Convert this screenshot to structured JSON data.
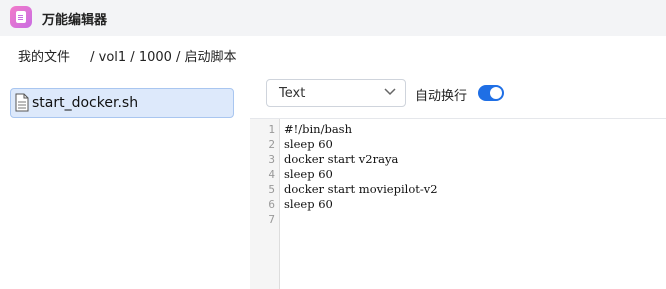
{
  "app": {
    "title": "万能编辑器",
    "icon": "document-edit-icon",
    "accent": "#c86de2"
  },
  "breadcrumb": {
    "root": "我的文件",
    "path": " / vol1 / 1000 / 启动脚本"
  },
  "sidebar": {
    "files": [
      {
        "name": "start_docker.sh",
        "icon": "file-icon",
        "selected": true
      }
    ]
  },
  "toolbar": {
    "language": "Text",
    "wrap_label": "自动换行",
    "wrap_enabled": true,
    "toggle_color": "#1f6fe5"
  },
  "editor": {
    "lines": [
      {
        "num": "1",
        "text": "#!/bin/bash"
      },
      {
        "num": "2",
        "text": "sleep 60"
      },
      {
        "num": "3",
        "text": "docker start v2raya"
      },
      {
        "num": "4",
        "text": "sleep 60"
      },
      {
        "num": "5",
        "text": "docker start moviepilot-v2"
      },
      {
        "num": "6",
        "text": "sleep 60"
      },
      {
        "num": "7",
        "text": ""
      }
    ]
  }
}
